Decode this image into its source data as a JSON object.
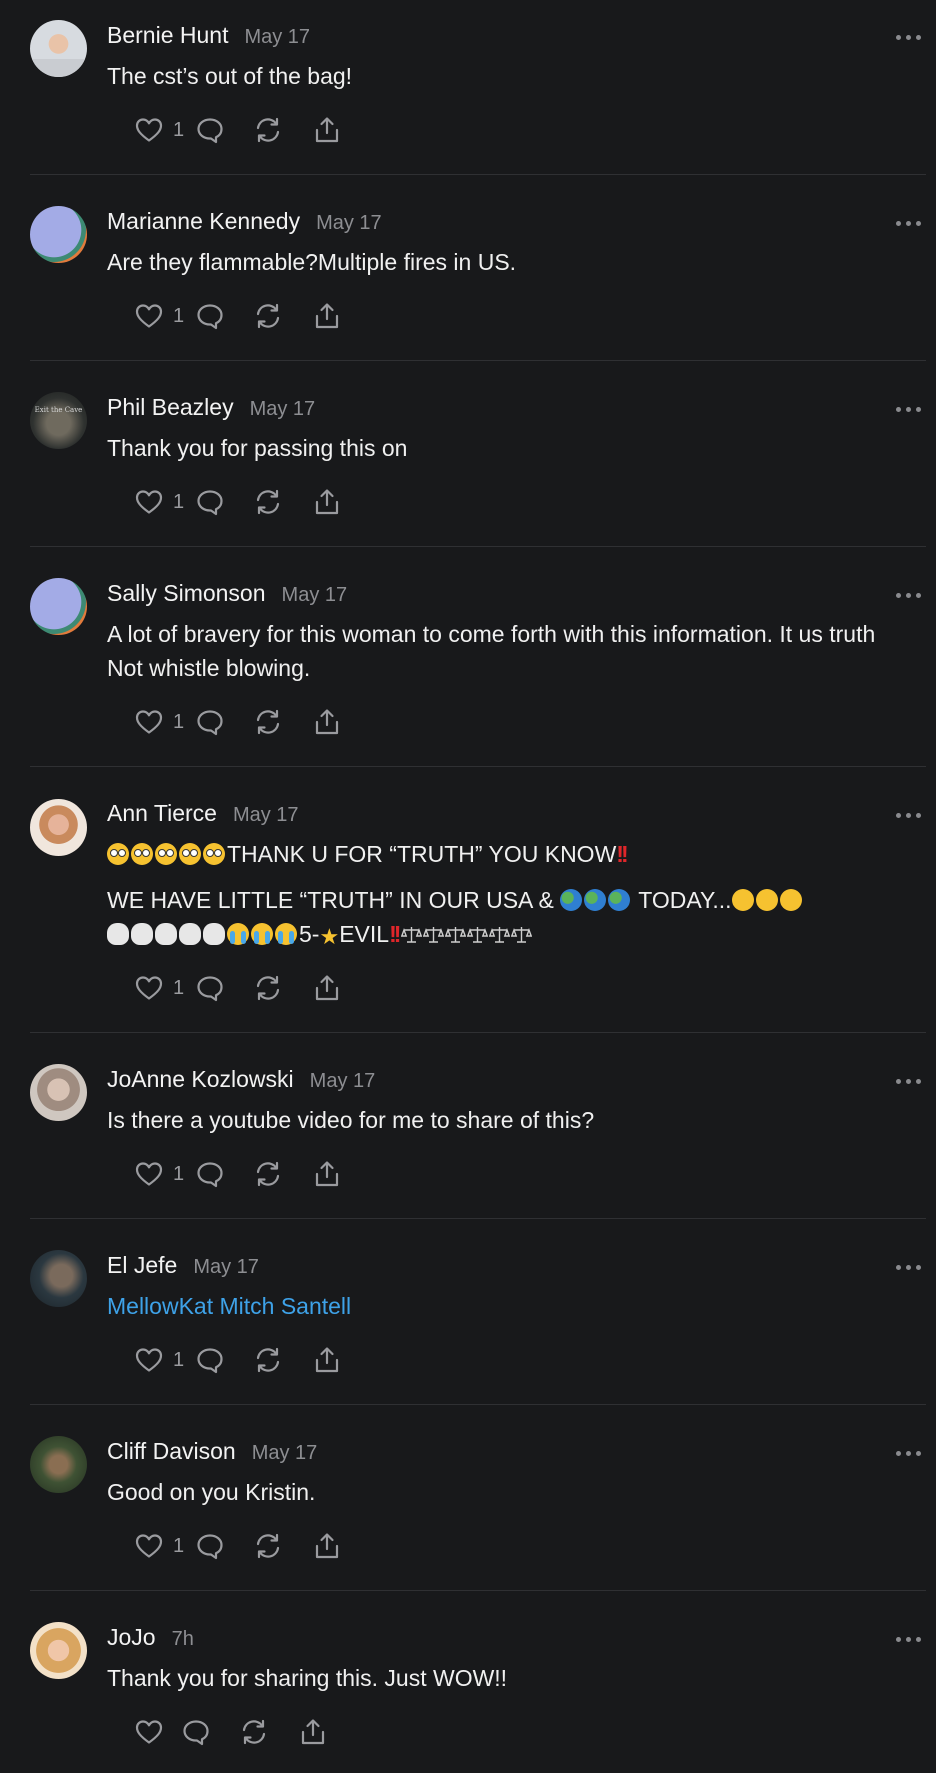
{
  "icons": {
    "like": "heart-icon",
    "reply": "comment-bubble-icon",
    "restack": "restack-icon",
    "share": "share-icon",
    "menu": "more-options-icon"
  },
  "colors": {
    "background": "#18191b",
    "link": "#3ea2e8",
    "muted": "#8d8e92",
    "divider": "#2f3033",
    "emoji_bang": "#e0262a"
  },
  "comments": [
    {
      "author": "Bernie Hunt",
      "date": "May 17",
      "text": "The cst’s out of the bag!",
      "likes": "1"
    },
    {
      "author": "Marianne Kennedy",
      "date": "May 17",
      "text": "Are they flammable?Multiple fires in US.",
      "likes": "1"
    },
    {
      "author": "Phil Beazley",
      "date": "May 17",
      "text": "Thank you for passing this on",
      "likes": "1",
      "avatar_text": "Exit the Cave"
    },
    {
      "author": "Sally Simonson",
      "date": "May 17",
      "text": "A lot of bravery for this woman to come forth with this information. It us truth Not whistle blowing.",
      "likes": "1"
    },
    {
      "author": "Ann Tierce",
      "date": "May 17",
      "line1_text": "THANK U FOR “TRUTH” YOU KNOW",
      "line2_text_a": "WE HAVE LITTLE “TRUTH” IN OUR USA & ",
      "line2_text_b": " TODAY...",
      "line3_text_a": "5-",
      "line3_text_b": "EVIL",
      "likes": "1"
    },
    {
      "author": "JoAnne Kozlowski",
      "date": "May 17",
      "text": "Is there a youtube video for me to share of this?",
      "likes": "1"
    },
    {
      "author": "El Jefe",
      "date": "May 17",
      "text": "MellowKat Mitch Santell",
      "likes": "1"
    },
    {
      "author": "Cliff Davison",
      "date": "May 17",
      "text": "Good on you Kristin.",
      "likes": "1"
    },
    {
      "author": "JoJo",
      "date": "7h",
      "text": "Thank you for sharing this. Just WOW!!"
    }
  ]
}
